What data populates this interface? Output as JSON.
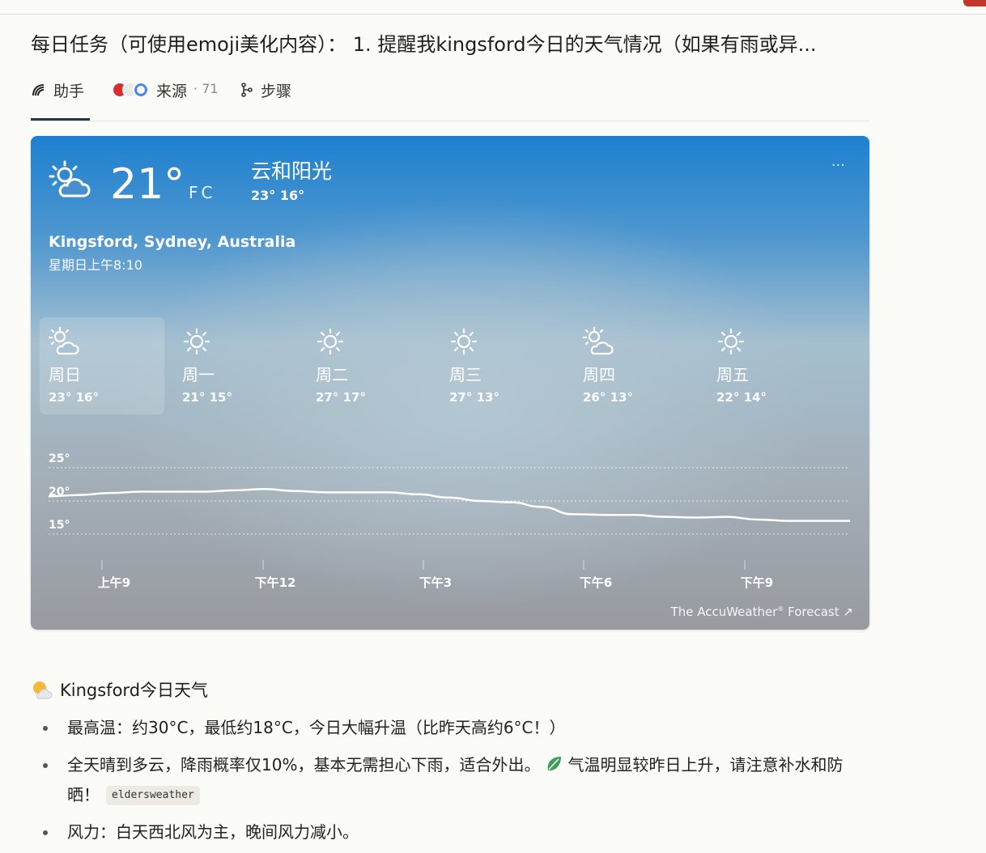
{
  "query": {
    "title": "每日任务（可使用emoji美化内容）：  1. 提醒我kingsford今日的天气情况（如果有雨或异..."
  },
  "tabs": [
    {
      "label": "助手",
      "icon": "assistant-icon",
      "active": true
    },
    {
      "label": "来源",
      "count": "· 71",
      "icon": "source-logos"
    },
    {
      "label": "步骤",
      "icon": "steps-icon"
    }
  ],
  "weather": {
    "current_temp": "21°",
    "unit_f": "F",
    "unit_c": "C",
    "condition": "云和阳光",
    "hilo": "23°  16°",
    "more": "···",
    "location": "Kingsford, Sydney, Australia",
    "datetime": "星期日上午8:10",
    "days": [
      {
        "name": "周日",
        "hilo": "23°  16°",
        "icon": "partly-cloudy-icon"
      },
      {
        "name": "周一",
        "hilo": "21°  15°",
        "icon": "sun-icon"
      },
      {
        "name": "周二",
        "hilo": "27°  17°",
        "icon": "sun-icon"
      },
      {
        "name": "周三",
        "hilo": "27°  13°",
        "icon": "sun-icon"
      },
      {
        "name": "周四",
        "hilo": "26°  13°",
        "icon": "partly-cloudy-icon"
      },
      {
        "name": "周五",
        "hilo": "22°  14°",
        "icon": "sun-icon"
      }
    ],
    "chart_data": {
      "type": "line",
      "x": [
        "上午9",
        "下午12",
        "下午3",
        "下午6",
        "下午9"
      ],
      "ylabels": [
        "25°",
        "20°",
        "15°"
      ],
      "ylim": [
        15,
        25
      ],
      "grid": true,
      "series": [
        {
          "values": [
            20.7,
            20.9,
            21.2,
            21.4,
            21.4,
            21.4,
            21.6,
            21.8,
            21.5,
            21.3,
            21.3,
            21.3,
            21.0,
            20.5,
            20.0,
            19.8,
            19.1,
            18.0,
            17.9,
            17.9,
            17.6,
            17.5,
            17.6,
            17.2,
            17.0,
            17.0,
            17.0
          ]
        }
      ]
    },
    "source_label": "The AccuWeather",
    "source_mark": "®",
    "source_suffix": "Forecast"
  },
  "answer": {
    "heading": "Kingsford今日天气",
    "bullets": [
      "最高温：约30°C，最低约18°C，今日大幅升温（比昨天高约6°C！）",
      "全天晴到多云，降雨概率仅10%，基本无需担心下雨，适合外出。",
      "风力：白天西北风为主，晚间风力减小。"
    ],
    "bullet2_cont": "气温明显较昨日上升，请注意补水和防晒！",
    "tag": "eldersweather"
  }
}
